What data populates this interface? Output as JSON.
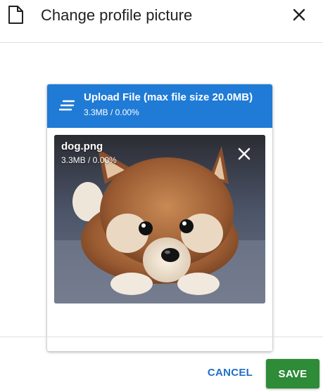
{
  "dialog": {
    "title": "Change profile picture",
    "icons": {
      "header_icon": "document-icon",
      "close_icon": "close-icon"
    }
  },
  "upload": {
    "title": "Upload File (max file size 20.0MB)",
    "progress_text": "3.3MB / 0.00%",
    "icon": "upload-lines-icon",
    "header_color": "#1f7bd6"
  },
  "file": {
    "name": "dog.png",
    "progress_text": "3.3MB / 0.00%",
    "remove_icon": "close-icon"
  },
  "footer": {
    "cancel_label": "CANCEL",
    "save_label": "SAVE",
    "cancel_color": "#1e6fc7",
    "save_color": "#2e8b37"
  }
}
